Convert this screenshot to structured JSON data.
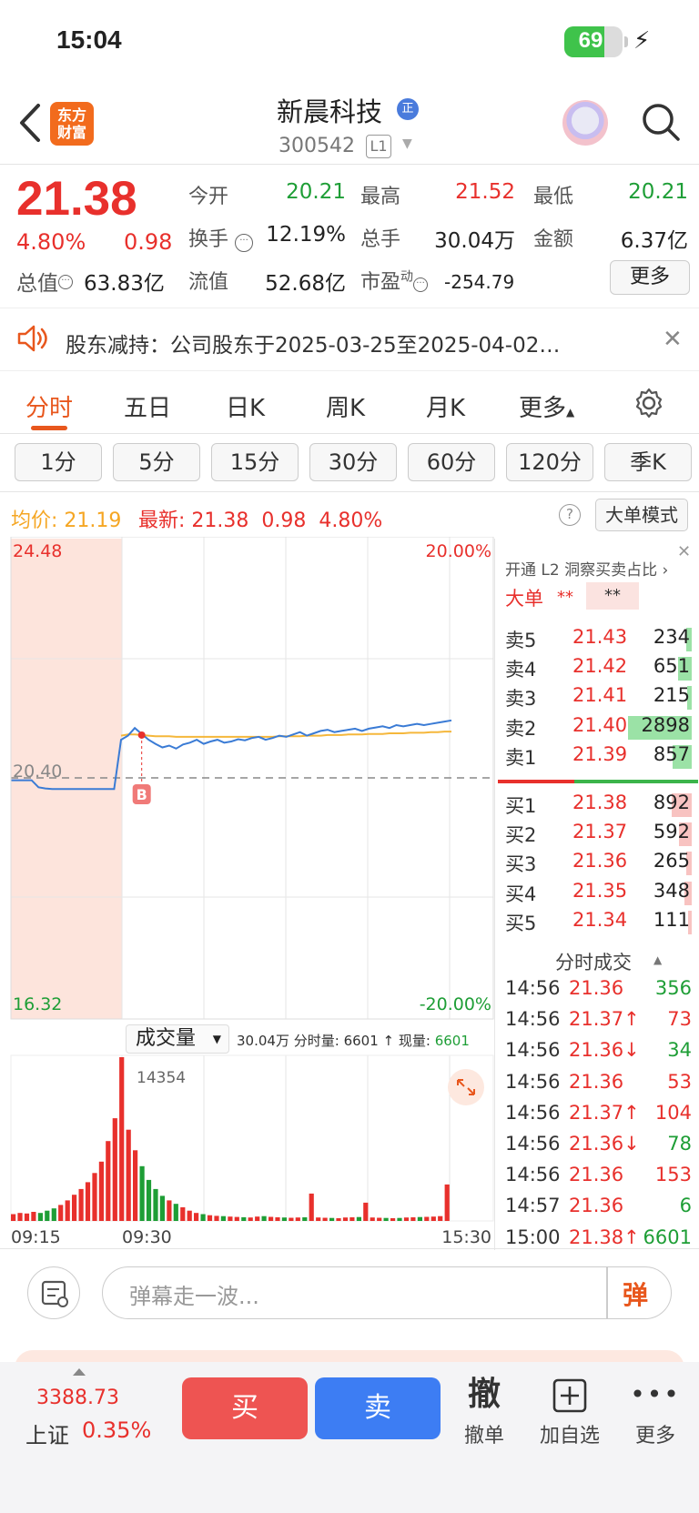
{
  "status_bar": {
    "time": "15:04",
    "battery": "69",
    "battery_level": 0.69
  },
  "header": {
    "logo_line1": "东方",
    "logo_line2": "财富",
    "stock_name": "新晨科技",
    "badge": "正",
    "code": "300542",
    "level": "L1"
  },
  "quote": {
    "price": "21.38",
    "change_pct": "4.80%",
    "change": "0.98",
    "open_label": "今开",
    "open": "20.21",
    "high_label": "最高",
    "high": "21.52",
    "low_label": "最低",
    "low": "20.21",
    "turnover_label": "换手",
    "turnover": "12.19%",
    "volume_label": "总手",
    "volume": "30.04万",
    "amount_label": "金额",
    "amount": "6.37亿",
    "mktcap_label": "总值",
    "mktcap": "63.83亿",
    "float_label": "流值",
    "float_cap": "52.68亿",
    "pe_label": "市盈",
    "pe_sup": "动",
    "pe": "-254.79",
    "more": "更多"
  },
  "notice": {
    "text": "股东减持：公司股东于2025-03-25至2025-04-02…"
  },
  "tabs": [
    "分时",
    "五日",
    "日K",
    "周K",
    "月K",
    "更多"
  ],
  "timeframes": [
    "1分",
    "5分",
    "15分",
    "30分",
    "60分",
    "120分",
    "季K"
  ],
  "info_line": {
    "avg_label": "均价:",
    "avg": "21.19",
    "latest_label": "最新:",
    "latest": "21.38",
    "latest_chg": "0.98",
    "latest_pct": "4.80%",
    "mode_button": "大单模式"
  },
  "chart_data": {
    "type": "line",
    "y_top": "24.48",
    "y_bottom": "16.32",
    "y_mid": "20.40",
    "pct_top": "20.00%",
    "pct_bottom": "-20.00%",
    "ylim": [
      16.32,
      24.48
    ],
    "prev_close": 20.4,
    "marker": "B",
    "price_series": [
      20.36,
      20.36,
      20.36,
      20.36,
      20.24,
      20.22,
      20.21,
      20.21,
      20.21,
      20.21,
      20.21,
      20.21,
      20.21,
      20.21,
      20.21,
      20.21,
      21.05,
      21.12,
      21.25,
      21.15,
      21.05,
      20.98,
      20.92,
      20.95,
      20.9,
      20.97,
      21.0,
      21.05,
      20.98,
      21.02,
      21.05,
      21.0,
      21.02,
      21.06,
      21.04,
      21.08,
      21.1,
      21.05,
      21.08,
      21.12,
      21.1,
      21.14,
      21.18,
      21.12,
      21.16,
      21.2,
      21.22,
      21.18,
      21.2,
      21.22,
      21.24,
      21.2,
      21.24,
      21.26,
      21.28,
      21.25,
      21.3,
      21.28,
      21.3,
      21.32,
      21.3,
      21.32,
      21.34,
      21.36,
      21.38
    ],
    "avg_series": [
      null,
      null,
      null,
      null,
      null,
      null,
      null,
      null,
      null,
      null,
      null,
      null,
      null,
      null,
      null,
      null,
      21.12,
      21.14,
      21.14,
      21.13,
      21.12,
      21.11,
      21.11,
      21.11,
      21.1,
      21.1,
      21.1,
      21.1,
      21.1,
      21.1,
      21.1,
      21.1,
      21.1,
      21.1,
      21.1,
      21.1,
      21.1,
      21.1,
      21.1,
      21.11,
      21.11,
      21.11,
      21.11,
      21.12,
      21.12,
      21.12,
      21.13,
      21.13,
      21.13,
      21.14,
      21.14,
      21.14,
      21.15,
      21.15,
      21.15,
      21.16,
      21.16,
      21.16,
      21.17,
      21.17,
      21.17,
      21.18,
      21.18,
      21.19,
      21.19
    ],
    "volume_label": "成交量",
    "volume_info_total": "30.04万",
    "volume_info_period_label": "分时量:",
    "volume_info_period": "6601",
    "volume_info_now_label": "现量:",
    "volume_info_now": "6601",
    "volume_max": "14354",
    "x_ticks": [
      "09:15",
      "09:30",
      "15:30"
    ],
    "volume_series": [
      600,
      700,
      650,
      800,
      700,
      900,
      1100,
      1400,
      1800,
      2300,
      2800,
      3400,
      4200,
      5200,
      7000,
      9000,
      14354,
      8000,
      6200,
      4800,
      3600,
      2800,
      2200,
      1800,
      1500,
      1200,
      900,
      700,
      600,
      500,
      450,
      420,
      380,
      350,
      330,
      300,
      380,
      420,
      360,
      320,
      300,
      280,
      300,
      320,
      2400,
      300,
      280,
      260,
      240,
      300,
      320,
      340,
      1600,
      300,
      280,
      260,
      240,
      260,
      300,
      320,
      340,
      360,
      380,
      420,
      3200
    ]
  },
  "order_book": {
    "banner": "开通 L2 洞察买卖占比",
    "big_label": "大单",
    "big_val1": "**",
    "big_val2": "**",
    "asks": [
      {
        "label": "卖5",
        "price": "21.43",
        "vol": "234",
        "bar": 0.08
      },
      {
        "label": "卖4",
        "price": "21.42",
        "vol": "651",
        "bar": 0.22
      },
      {
        "label": "卖3",
        "price": "21.41",
        "vol": "215",
        "bar": 0.07
      },
      {
        "label": "卖2",
        "price": "21.40",
        "vol": "2898",
        "bar": 1.0
      },
      {
        "label": "卖1",
        "price": "21.39",
        "vol": "857",
        "bar": 0.3
      }
    ],
    "bids": [
      {
        "label": "买1",
        "price": "21.38",
        "vol": "892",
        "bar": 0.31
      },
      {
        "label": "买2",
        "price": "21.37",
        "vol": "592",
        "bar": 0.2
      },
      {
        "label": "买3",
        "price": "21.36",
        "vol": "265",
        "bar": 0.09
      },
      {
        "label": "买4",
        "price": "21.35",
        "vol": "348",
        "bar": 0.12
      },
      {
        "label": "买5",
        "price": "21.34",
        "vol": "111",
        "bar": 0.04
      }
    ],
    "ask_ratio": 0.38
  },
  "ticks": {
    "title": "分时成交",
    "rows": [
      {
        "time": "14:56",
        "price": "21.36",
        "vol": "356",
        "dir": "",
        "color": "green"
      },
      {
        "time": "14:56",
        "price": "21.37↑",
        "vol": "73",
        "dir": "up",
        "color": "red"
      },
      {
        "time": "14:56",
        "price": "21.36↓",
        "vol": "34",
        "dir": "down",
        "color": "green"
      },
      {
        "time": "14:56",
        "price": "21.36",
        "vol": "53",
        "dir": "",
        "color": "red"
      },
      {
        "time": "14:56",
        "price": "21.37↑",
        "vol": "104",
        "dir": "up",
        "color": "red"
      },
      {
        "time": "14:56",
        "price": "21.36↓",
        "vol": "78",
        "dir": "down",
        "color": "green"
      },
      {
        "time": "14:56",
        "price": "21.36",
        "vol": "153",
        "dir": "",
        "color": "red"
      },
      {
        "time": "14:57",
        "price": "21.36",
        "vol": "6",
        "dir": "",
        "color": "green"
      },
      {
        "time": "15:00",
        "price": "21.38↑",
        "vol": "6601",
        "dir": "up",
        "color": "green"
      }
    ]
  },
  "danmaku": {
    "placeholder": "弹幕走一波...",
    "button": "弹"
  },
  "bottom_bar": {
    "index_value": "3388.73",
    "index_name": "上证",
    "index_pct": "0.35%",
    "buy": "买",
    "sell": "卖",
    "cancel_icon": "撤",
    "cancel": "撤单",
    "watchlist": "加自选",
    "more": "更多"
  },
  "colors": {
    "up": "#e8302c",
    "down": "#1e9e36",
    "accent": "#e8571d",
    "price_line": "#3a7bd5",
    "avg_line": "#f5b73b"
  }
}
